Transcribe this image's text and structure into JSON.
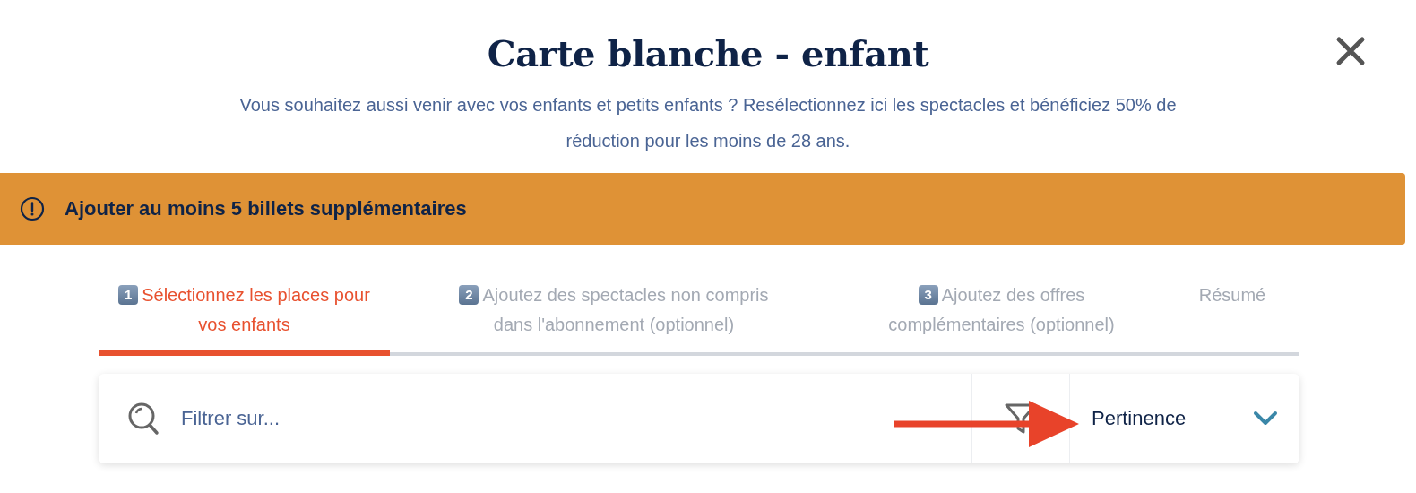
{
  "dialog": {
    "title": "Carte blanche - enfant",
    "subtitle": "Vous souhaitez aussi venir avec vos enfants et petits enfants ? Resélectionnez ici les spectacles et bénéficiez 50% de réduction pour les moins de 28 ans."
  },
  "alert": {
    "text": "Ajouter au moins 5 billets supplémentaires"
  },
  "steps": [
    {
      "number": "1",
      "label": "Sélectionnez les places pour vos enfants",
      "selected": true
    },
    {
      "number": "2",
      "label": "Ajoutez des spectacles non compris dans l'abonnement (optionnel)",
      "selected": false
    },
    {
      "number": "3",
      "label": "Ajoutez des offres complémentaires (optionnel)",
      "selected": false
    },
    {
      "label": "Résumé",
      "selected": false
    }
  ],
  "search": {
    "placeholder": "Filtrer sur..."
  },
  "sort": {
    "value": "Pertinence"
  }
}
